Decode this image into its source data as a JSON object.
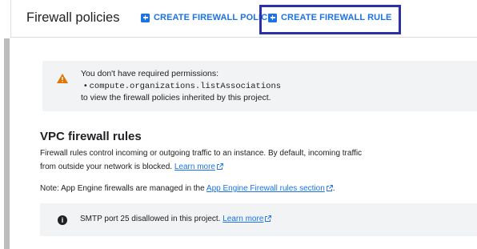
{
  "header": {
    "title": "Firewall policies",
    "actions": [
      {
        "label": "CREATE FIREWALL POLICY",
        "icon": "add-box-icon"
      },
      {
        "label": "CREATE FIREWALL RULE",
        "icon": "add-box-icon"
      }
    ]
  },
  "permissions_warning": {
    "icon": "warning-icon",
    "intro": "You don't have required permissions:",
    "bullet": "•",
    "permission": "compute.organizations.listAssociations",
    "outro": "to view the firewall policies inherited by this project."
  },
  "vpc": {
    "title": "VPC firewall rules",
    "description": "Firewall rules control incoming or outgoing traffic to an instance. By default, incoming traffic from outside your network is blocked.",
    "learn_more": "Learn more",
    "note_prefix": "Note: App Engine firewalls are managed in the",
    "note_link": "App Engine Firewall rules section",
    "note_suffix": "."
  },
  "smtp_notice": {
    "icon": "info-icon",
    "text": "SMTP port 25 disallowed in this project.",
    "learn_more": "Learn more"
  },
  "colors": {
    "accent": "#1a73e8",
    "warning": "#e37400",
    "highlight": "#2a31a8",
    "panel": "#f1f3f4"
  }
}
